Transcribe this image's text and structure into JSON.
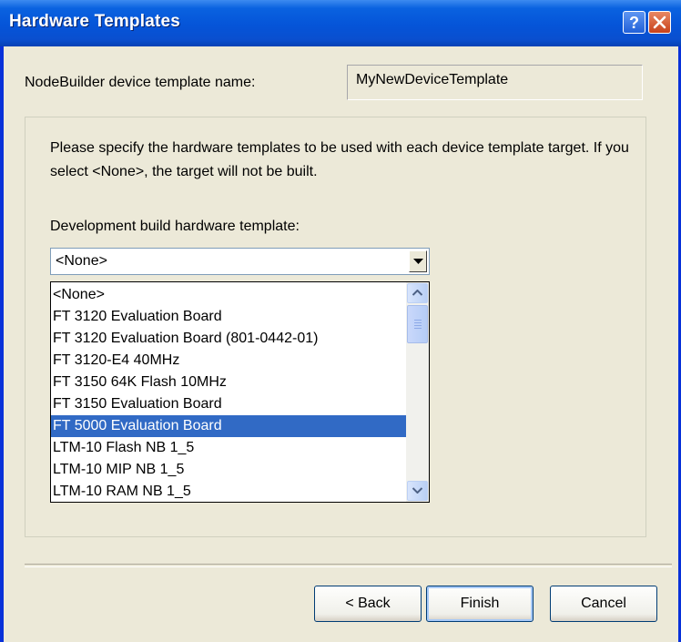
{
  "window": {
    "title": "Hardware Templates"
  },
  "device_template": {
    "label": "NodeBuilder device template name:",
    "value": "MyNewDeviceTemplate"
  },
  "instructions": "Please specify the hardware templates to be used with each device template target. If you select <None>, the target will not be built.",
  "development_build": {
    "label": "Development build hardware template:",
    "selected_value": "<None>",
    "options": [
      "<None>",
      "FT 3120 Evaluation Board",
      "FT 3120 Evaluation Board (801-0442-01)",
      "FT 3120-E4 40MHz",
      "FT 3150 64K Flash 10MHz",
      "FT 3150 Evaluation Board",
      "FT 5000 Evaluation Board",
      "LTM-10 Flash NB 1_5",
      "LTM-10 MIP NB 1_5",
      "LTM-10 RAM NB 1_5"
    ],
    "highlighted_option": "FT 5000 Evaluation Board"
  },
  "buttons": {
    "back": "< Back",
    "finish": "Finish",
    "cancel": "Cancel"
  },
  "colors": {
    "title_bar": "#0554d8",
    "dialog_bg": "#ece9d8",
    "selection": "#316ac5"
  }
}
